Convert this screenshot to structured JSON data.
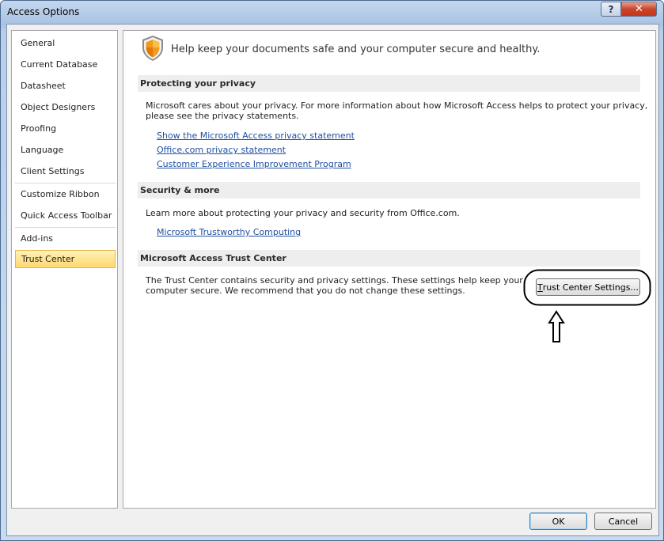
{
  "window": {
    "title": "Access Options",
    "help_label": "?",
    "close_label": "✕"
  },
  "nav": {
    "items": [
      {
        "label": "General"
      },
      {
        "label": "Current Database"
      },
      {
        "label": "Datasheet"
      },
      {
        "label": "Object Designers"
      },
      {
        "label": "Proofing"
      },
      {
        "label": "Language"
      },
      {
        "label": "Client Settings"
      },
      {
        "label": "Customize Ribbon"
      },
      {
        "label": "Quick Access Toolbar"
      },
      {
        "label": "Add-ins"
      },
      {
        "label": "Trust Center"
      }
    ],
    "selected": "Trust Center"
  },
  "main": {
    "headline": "Help keep your documents safe and your computer secure and healthy.",
    "icon": "shield-icon",
    "privacy": {
      "heading": "Protecting your privacy",
      "text_line1": "Microsoft cares about your privacy. For more information about how Microsoft Access helps to protect your privacy,",
      "text_line2": "please see the privacy statements.",
      "links": [
        "Show the Microsoft Access privacy statement",
        "Office.com privacy statement",
        "Customer Experience Improvement Program"
      ]
    },
    "security": {
      "heading": "Security & more",
      "text": "Learn more about protecting your privacy and security from Office.com.",
      "link": "Microsoft Trustworthy Computing"
    },
    "trust_center": {
      "heading": "Microsoft Access Trust Center",
      "text_line1": "The Trust Center contains security and privacy settings. These settings help keep your",
      "text_line2": "computer secure. We recommend that you do not change these settings.",
      "button_first": "T",
      "button_rest": "rust Center Settings..."
    }
  },
  "footer": {
    "ok_label": "OK",
    "cancel_label": "Cancel"
  },
  "colors": {
    "link": "#1f4f9e",
    "selected_nav": "#ffd86f",
    "close_button": "#c9462b"
  }
}
